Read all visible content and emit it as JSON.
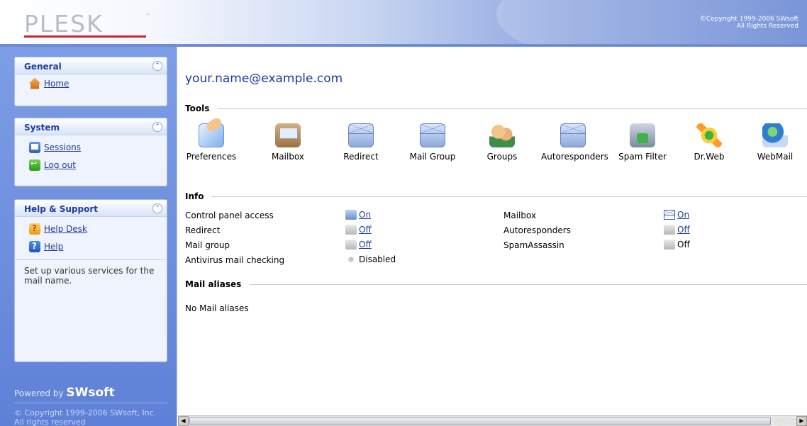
{
  "header": {
    "logo": "PLESK",
    "logo_tm": "™",
    "copyright_line1": "©Copyright 1999-2006 SWsoft",
    "copyright_line2": "All Rights Reserved"
  },
  "sidebar": {
    "panels": [
      {
        "title": "General",
        "items": [
          {
            "label": "Home",
            "icon": "home-icon"
          }
        ]
      },
      {
        "title": "System",
        "items": [
          {
            "label": "Sessions",
            "icon": "sessions-icon"
          },
          {
            "label": "Log out",
            "icon": "logout-icon"
          }
        ]
      },
      {
        "title": "Help & Support",
        "items": [
          {
            "label": "Help Desk",
            "icon": "help-desk-icon"
          },
          {
            "label": "Help",
            "icon": "help-icon"
          }
        ],
        "description": "Set up various services for the mail name."
      }
    ],
    "collapse_glyph": "⌃",
    "powered_by": "Powered by",
    "powered_brand": "SWsoft",
    "copyright_line1": "© Copyright 1999-2006 SWsoft, Inc.",
    "copyright_line2": "All rights reserved"
  },
  "main": {
    "mail_name": "your.name@example.com",
    "tools_heading": "Tools",
    "tools": [
      {
        "label": "Preferences",
        "icon": "preferences-icon"
      },
      {
        "label": "Mailbox",
        "icon": "mailbox-icon"
      },
      {
        "label": "Redirect",
        "icon": "redirect-icon"
      },
      {
        "label": "Mail Group",
        "icon": "mail-group-icon"
      },
      {
        "label": "Groups",
        "icon": "groups-icon"
      },
      {
        "label": "Autoresponders",
        "icon": "autoresponders-icon"
      },
      {
        "label": "Spam Filter",
        "icon": "spam-filter-icon"
      },
      {
        "label": "Dr.Web",
        "icon": "drweb-icon"
      },
      {
        "label": "WebMail",
        "icon": "webmail-icon"
      }
    ],
    "info_heading": "Info",
    "info_left": [
      {
        "label": "Control panel access",
        "value": "On",
        "link": true,
        "icon": "control-panel-icon"
      },
      {
        "label": "Redirect",
        "value": "Off",
        "link": true,
        "icon": "redirect-status-icon"
      },
      {
        "label": "Mail group",
        "value": "Off",
        "link": true,
        "icon": "mail-group-status-icon"
      },
      {
        "label": "Antivirus mail checking",
        "value": "Disabled",
        "link": false,
        "icon": "antivirus-icon"
      }
    ],
    "info_right": [
      {
        "label": "Mailbox",
        "value": "On",
        "link": true,
        "icon": "mailbox-status-icon"
      },
      {
        "label": "Autoresponders",
        "value": "Off",
        "link": true,
        "icon": "autoresponders-status-icon"
      },
      {
        "label": "SpamAssassin",
        "value": "Off",
        "link": false,
        "icon": "spamassassin-icon"
      }
    ],
    "aliases_heading": "Mail aliases",
    "no_aliases": "No Mail aliases"
  },
  "scrollbar": {
    "left_arrow": "◀",
    "right_arrow": "▶"
  },
  "colors": {
    "accent": "#1e3d9b",
    "sidebar": "#6c8ddd",
    "logo_underline": "#d4212d"
  }
}
